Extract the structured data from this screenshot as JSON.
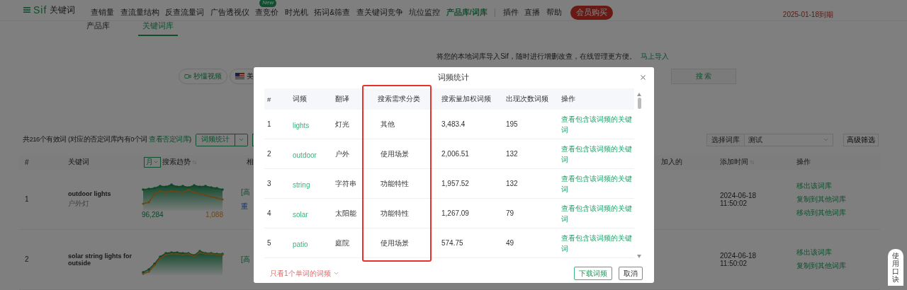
{
  "nav": {
    "brand": "Sif",
    "brand_sub": "关键词",
    "items": [
      {
        "label": "查销量",
        "selected": false
      },
      {
        "label": "查流量结构",
        "selected": false
      },
      {
        "label": "反查流量词",
        "selected": false
      },
      {
        "label": "广告透视仪",
        "selected": false
      },
      {
        "label": "查竞价",
        "selected": false,
        "badge": "New"
      },
      {
        "label": "时光机",
        "selected": false
      },
      {
        "label": "拓词&筛查",
        "selected": false
      },
      {
        "label": "查关键词竞争",
        "selected": false
      },
      {
        "label": "坑位监控",
        "selected": false
      },
      {
        "label": "产品库/词库",
        "selected": true
      }
    ],
    "extra_items": [
      "插件",
      "直播",
      "帮助"
    ],
    "vip_button": "会员购买",
    "expiry": "2025-01-18到期"
  },
  "subtabs": [
    {
      "label": "产品库",
      "selected": false
    },
    {
      "label": "关键词库",
      "selected": true
    }
  ],
  "import_banner": {
    "text": "将您的本地词库导入Sif，随时进行增删改查，在线管理更方便。",
    "link": "马上导入"
  },
  "search_bar": {
    "video_button": "秒懂视频",
    "market": "美",
    "search_button": "搜 索"
  },
  "toolbar": {
    "summary_before": "共216个有效词 (对应的否定词库内有0个词",
    "summary_link": "查看否定词库",
    "summary_after": ")",
    "stats_button": "词频统计",
    "library_label": "选择词库",
    "library_value": "测试",
    "filter_button": "高级筛选"
  },
  "table": {
    "columns": [
      "#",
      "关键词",
      "搜索趋势",
      "相",
      "加入的",
      "添加时间",
      "操作"
    ],
    "trend_period": "月",
    "rows": [
      {
        "index": "1",
        "keyword": "outdoor lights",
        "translation": "户外灯",
        "trend_labels": [
          "96,284",
          "1,088"
        ],
        "related": [
          "[高",
          "重"
        ],
        "added": "2024-06-18 11:50:02",
        "actions": [
          "移出该词库",
          "复制到其他词库",
          "移动到其他词库"
        ]
      },
      {
        "index": "2",
        "keyword": "solar string lights for outside",
        "related": [
          "[高"
        ],
        "added": "2024-06-18 11:50:02",
        "actions": [
          "移出该词库",
          "复制到其他词库"
        ]
      }
    ]
  },
  "modal": {
    "title": "词频统计",
    "columns": [
      "#",
      "词频",
      "翻译",
      "搜索需求分类",
      "搜索量加权词频",
      "出现次数词频",
      "操作"
    ],
    "rows": [
      {
        "index": "1",
        "word": "lights",
        "translation": "灯光",
        "category": "其他",
        "weighted": "3,483.4",
        "count": "195",
        "action": "查看包含该词频的关键词"
      },
      {
        "index": "2",
        "word": "outdoor",
        "translation": "户外",
        "category": "使用场景",
        "weighted": "2,006.51",
        "count": "132",
        "action": "查看包含该词频的关键词"
      },
      {
        "index": "3",
        "word": "string",
        "translation": "字符串",
        "category": "功能特性",
        "weighted": "1,957.52",
        "count": "132",
        "action": "查看包含该词频的关键词"
      },
      {
        "index": "4",
        "word": "solar",
        "translation": "太阳能",
        "category": "功能特性",
        "weighted": "1,267.09",
        "count": "79",
        "action": "查看包含该词频的关键词"
      },
      {
        "index": "5",
        "word": "patio",
        "translation": "庭院",
        "category": "使用场景",
        "weighted": "574.75",
        "count": "49",
        "action": "查看包含该词频的关键词"
      }
    ],
    "filter_link": "只看1个单词的词频",
    "buttons": [
      {
        "label": "下载词频",
        "kind": "primary"
      },
      {
        "label": "取消",
        "kind": "default"
      }
    ]
  },
  "side_tab": "使用口诀"
}
